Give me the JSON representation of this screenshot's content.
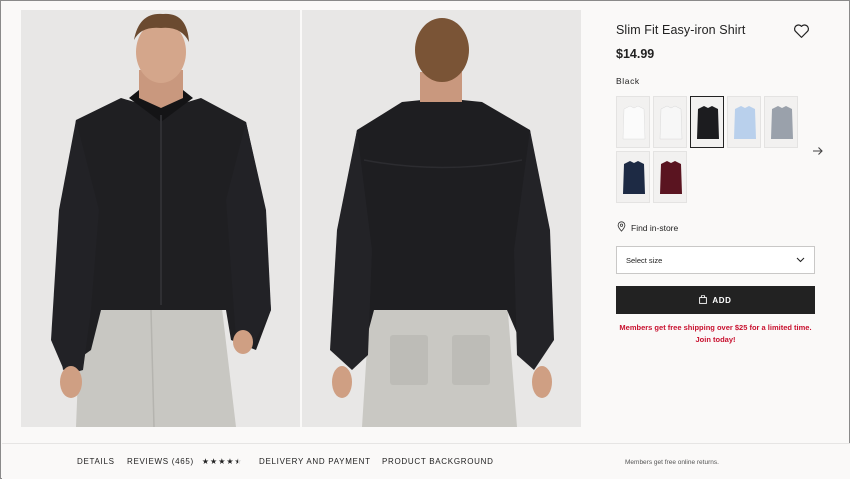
{
  "product": {
    "title": "Slim Fit Easy-iron Shirt",
    "price": "$14.99",
    "color_label": "Black",
    "find_in_store": "Find in-store",
    "size_select_placeholder": "Select size",
    "add_label": "ADD",
    "promo_line1": "Members get free shipping over $25 for a limited time.",
    "promo_line2": "Join today!"
  },
  "swatches": [
    {
      "color": "white",
      "hex": "#f6f6f6"
    },
    {
      "color": "white-2",
      "hex": "#f1f1f1"
    },
    {
      "color": "black",
      "hex": "#1c1c1f",
      "selected": true
    },
    {
      "color": "light-blue",
      "hex": "#b9d0ec"
    },
    {
      "color": "gray-check",
      "hex": "#9aa1ab"
    },
    {
      "color": "navy",
      "hex": "#1d2a44"
    },
    {
      "color": "burgundy",
      "hex": "#5a1420"
    }
  ],
  "tabs": {
    "details": "DETAILS",
    "reviews": "REVIEWS (465)",
    "delivery": "DELIVERY AND PAYMENT",
    "background": "PRODUCT BACKGROUND"
  },
  "rating": {
    "value": 4.5,
    "max": 5
  },
  "footer": {
    "returns": "Members get free online returns."
  },
  "icons": [
    "heart-icon",
    "arrow-right-icon",
    "location-pin-icon",
    "chevron-down-icon",
    "bag-icon",
    "star-icon"
  ],
  "colors": {
    "accent_red": "#c8102e",
    "button_black": "#222222",
    "background": "#faf9f8"
  }
}
